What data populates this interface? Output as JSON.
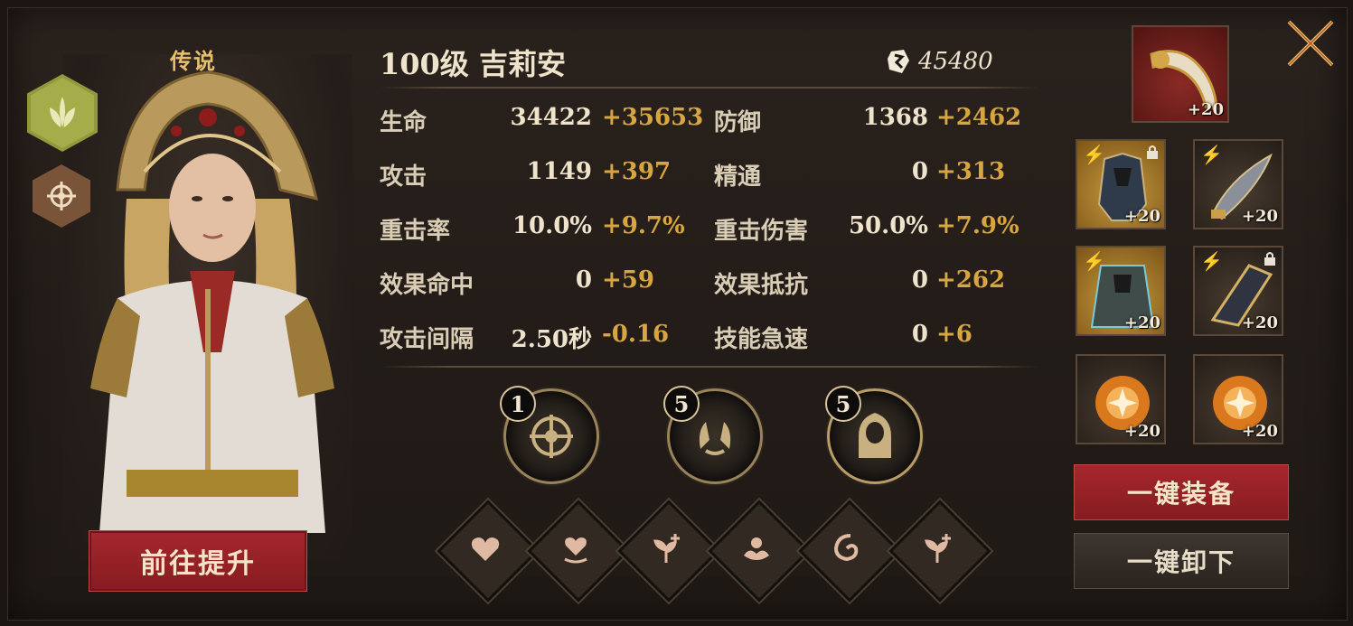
{
  "hero": {
    "rarity": "传说",
    "upgrade_label": "前往提升"
  },
  "header": {
    "name": "100级  吉莉安",
    "power_icon": "gem-icon",
    "power_value": "45480"
  },
  "stats": [
    {
      "label": "生命",
      "base": "34422",
      "bonus": "+35653"
    },
    {
      "label": "防御",
      "base": "1368",
      "bonus": "+2462"
    },
    {
      "label": "攻击",
      "base": "1149",
      "bonus": "+397"
    },
    {
      "label": "精通",
      "base": "0",
      "bonus": "+313"
    },
    {
      "label": "重击率",
      "base": "10.0%",
      "bonus": "+9.7%"
    },
    {
      "label": "重击伤害",
      "base": "50.0%",
      "bonus": "+7.9%"
    },
    {
      "label": "效果命中",
      "base": "0",
      "bonus": "+59"
    },
    {
      "label": "效果抵抗",
      "base": "0",
      "bonus": "+262"
    },
    {
      "label": "攻击间隔",
      "base": "2.50秒",
      "bonus": "-0.16"
    },
    {
      "label": "技能急速",
      "base": "0",
      "bonus": "+6"
    }
  ],
  "skills": [
    {
      "level": "1",
      "icon": "compass-skill-icon"
    },
    {
      "level": "5",
      "icon": "hands-skill-icon"
    },
    {
      "level": "5",
      "icon": "hooded-figure-skill-icon"
    }
  ],
  "runes": [
    {
      "icon": "heart-icon"
    },
    {
      "icon": "heart-heal-icon"
    },
    {
      "icon": "sprout-plus-icon"
    },
    {
      "icon": "lotus-icon"
    },
    {
      "icon": "swirl-icon"
    },
    {
      "icon": "sprout-plus-icon"
    }
  ],
  "equipment": {
    "artifact": {
      "enhance": "+20",
      "icon": "horn-icon"
    },
    "slots": [
      {
        "enhance": "+20",
        "icon": "armor-icon",
        "locked": true
      },
      {
        "enhance": "+20",
        "icon": "dagger-icon",
        "locked": false
      },
      {
        "enhance": "+20",
        "icon": "cloak-icon",
        "locked": false
      },
      {
        "enhance": "+20",
        "icon": "gauntlet-icon",
        "locked": true
      },
      {
        "enhance": "+20",
        "icon": "orb-icon",
        "locked": false
      },
      {
        "enhance": "+20",
        "icon": "orb-icon",
        "locked": false
      }
    ],
    "equip_all_label": "一键装备",
    "unequip_all_label": "一键卸下"
  },
  "colors": {
    "accent_gold": "#d8a641",
    "button_red": "#a5272c",
    "rarity_gold": "#e6c06a"
  }
}
